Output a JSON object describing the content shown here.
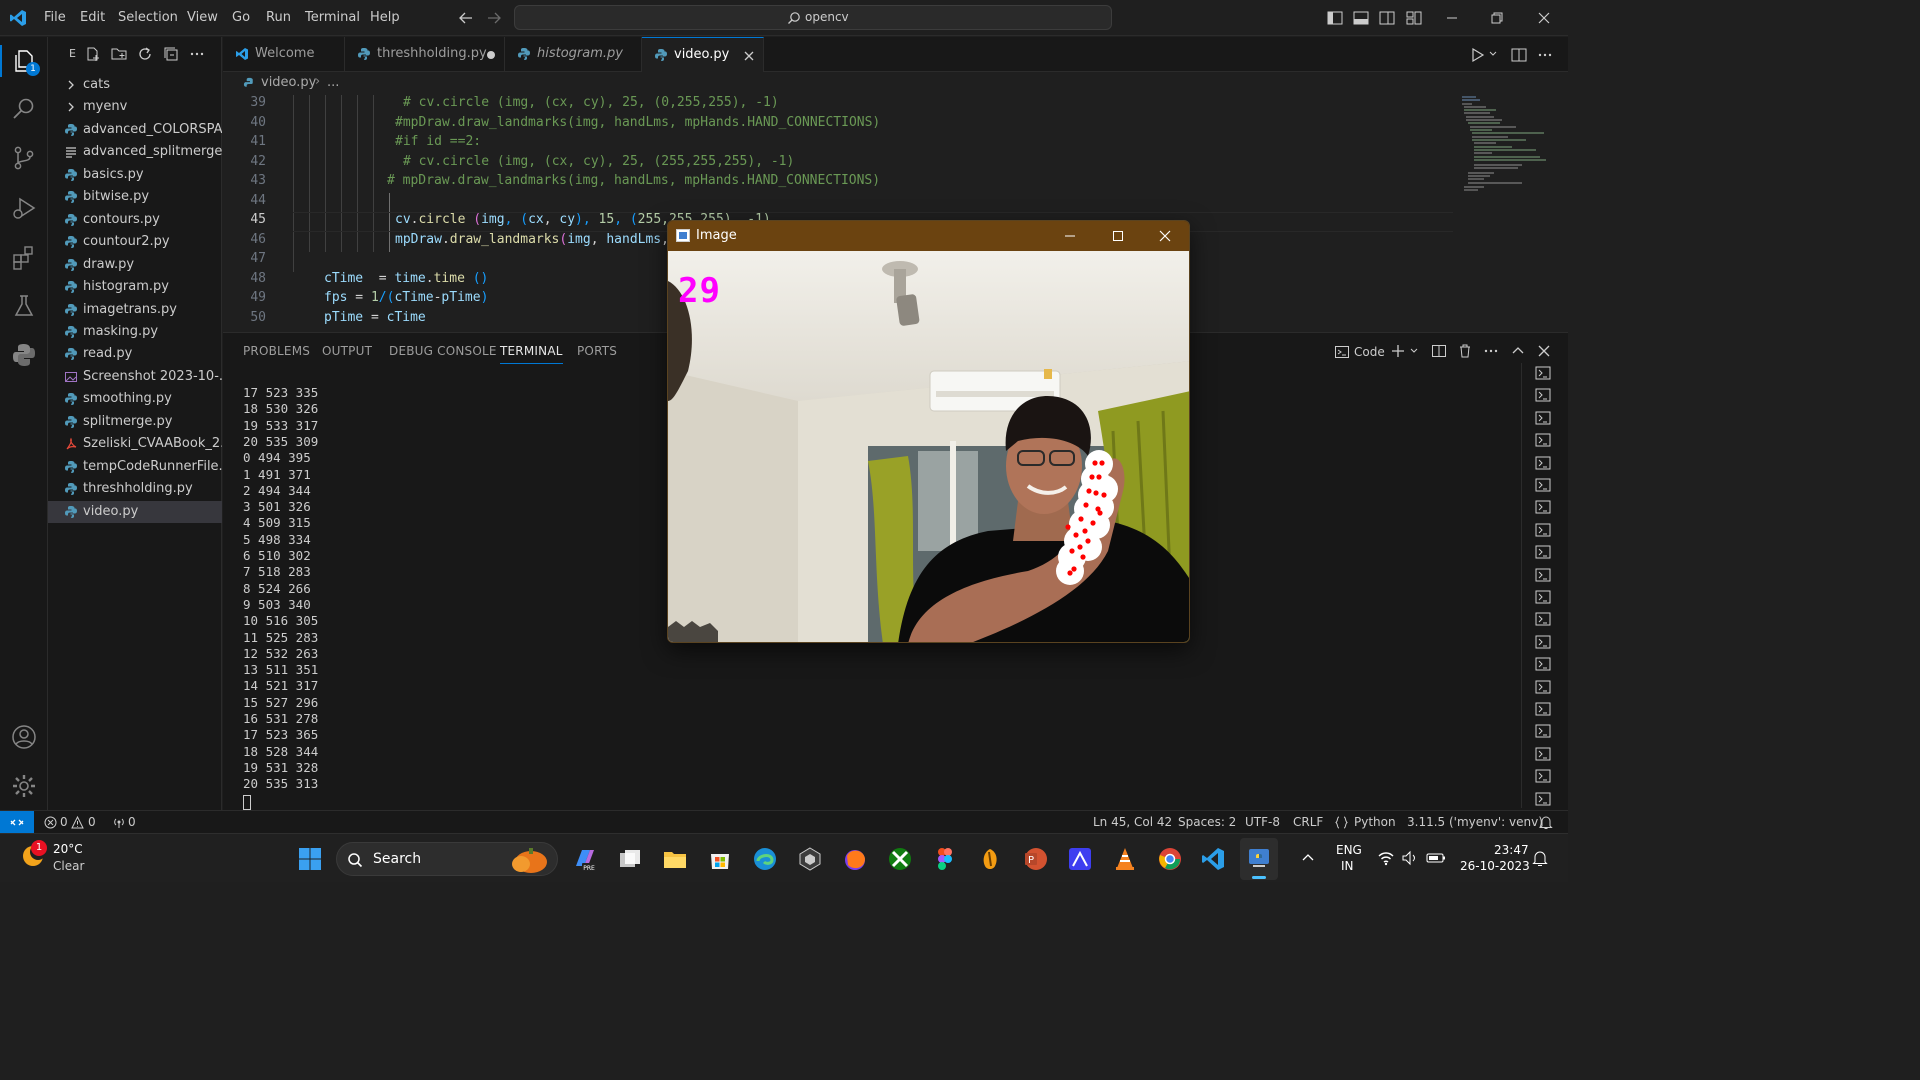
{
  "titlebar": {
    "menu": [
      "File",
      "Edit",
      "Selection",
      "View",
      "Go",
      "Run",
      "Terminal",
      "Help"
    ],
    "command_center": "opencv"
  },
  "activity": {
    "explorer_badge": "1"
  },
  "sidebar": {
    "header_letter": "E",
    "items": [
      {
        "label": "cats",
        "type": "folder"
      },
      {
        "label": "myenv",
        "type": "folder"
      },
      {
        "label": "advanced_COLORSPA...",
        "type": "py"
      },
      {
        "label": "advanced_splitmerge",
        "type": "txt"
      },
      {
        "label": "basics.py",
        "type": "py"
      },
      {
        "label": "bitwise.py",
        "type": "py"
      },
      {
        "label": "contours.py",
        "type": "py"
      },
      {
        "label": "countour2.py",
        "type": "py"
      },
      {
        "label": "draw.py",
        "type": "py"
      },
      {
        "label": "histogram.py",
        "type": "py"
      },
      {
        "label": "imagetrans.py",
        "type": "py"
      },
      {
        "label": "masking.py",
        "type": "py"
      },
      {
        "label": "read.py",
        "type": "py"
      },
      {
        "label": "Screenshot 2023-10-...",
        "type": "img"
      },
      {
        "label": "smoothing.py",
        "type": "py"
      },
      {
        "label": "splitmerge.py",
        "type": "py"
      },
      {
        "label": "Szeliski_CVAABook_2...",
        "type": "pdf"
      },
      {
        "label": "tempCodeRunnerFile....",
        "type": "py"
      },
      {
        "label": "threshholding.py",
        "type": "py"
      },
      {
        "label": "video.py",
        "type": "py",
        "selected": true
      }
    ]
  },
  "tabs": [
    {
      "label": "Welcome",
      "italic": false
    },
    {
      "label": "threshholding.py",
      "italic": false,
      "modified": true
    },
    {
      "label": "histogram.py",
      "italic": true
    },
    {
      "label": "video.py",
      "italic": false,
      "active": true
    }
  ],
  "breadcrumb": {
    "file": "video.py",
    "rest": "..."
  },
  "code": {
    "line_numbers": [
      "39",
      "40",
      "41",
      "42",
      "43",
      "44",
      "45",
      "46",
      "47",
      "48",
      "49",
      "50"
    ],
    "current_line": "45",
    "l39": "# cv.circle (img, (cx, cy), 25, (0,255,255), -1)",
    "l40": "#mpDraw.draw_landmarks(img, handLms, mpHands.HAND_CONNECTIONS)",
    "l41": "#if id ==2:",
    "l42": "# cv.circle (img, (cx, cy), 25, (255,255,255), -1)",
    "l43": "# mpDraw.draw_landmarks(img, handLms, mpHands.HAND_CONNECTIONS)",
    "l45_a": "cv",
    "l45_b": ".",
    "l45_c": "circle",
    "l45_d": " (",
    "l45_e": "img",
    "l45_f": ", (",
    "l45_g": "cx",
    "l45_h": ", ",
    "l45_i": "cy",
    "l45_j": "), ",
    "l45_k": "15",
    "l45_l": ", (",
    "l45_m": "255",
    "l45_n": ",255,255), -1)",
    "l46_a": "mpDraw",
    "l46_b": ".",
    "l46_c": "draw_landmarks",
    "l46_d": "(",
    "l46_e": "img",
    "l46_f": ", ",
    "l46_g": "handLms",
    "l46_h": ",",
    "l48_a": "cTime",
    "l48_b": "  = ",
    "l48_c": "time",
    "l48_d": ".",
    "l48_e": "time",
    "l48_f": " ()",
    "l49_a": "fps",
    "l49_b": " = ",
    "l49_c": "1",
    "l49_d": "/(",
    "l49_e": "cTime",
    "l49_f": "-",
    "l49_g": "pTime",
    "l49_h": ")",
    "l50_a": "pTime",
    "l50_b": " = ",
    "l50_c": "cTime"
  },
  "panel": {
    "tabs": [
      "PROBLEMS",
      "OUTPUT",
      "DEBUG CONSOLE",
      "TERMINAL",
      "PORTS"
    ],
    "active_tab": "TERMINAL",
    "shell_label": "Code",
    "terminal_lines": [
      "17 523 335",
      "18 530 326",
      "19 533 317",
      "20 535 309",
      "0 494 395",
      "1 491 371",
      "2 494 344",
      "3 501 326",
      "4 509 315",
      "5 498 334",
      "6 510 302",
      "7 518 283",
      "8 524 266",
      "9 503 340",
      "10 516 305",
      "11 525 283",
      "12 532 263",
      "13 511 351",
      "14 521 317",
      "15 527 296",
      "16 531 278",
      "17 523 365",
      "18 528 344",
      "19 531 328",
      "20 535 313"
    ]
  },
  "image_window": {
    "title": "Image",
    "fps_overlay": "29"
  },
  "statusbar": {
    "errors": "0",
    "warnings": "0",
    "ports": "0",
    "cursor": "Ln 45, Col 42",
    "spaces": "Spaces: 2",
    "encoding": "UTF-8",
    "eol": "CRLF",
    "language": "Python",
    "interpreter": "3.11.5 ('myenv': venv)"
  },
  "taskbar": {
    "weather_temp": "20°C",
    "weather_desc": "Clear",
    "weather_badge": "1",
    "search": "Search",
    "lang_top": "ENG",
    "lang_bottom": "IN",
    "time": "23:47",
    "date": "26-10-2023"
  },
  "colors": {
    "accent": "#0078d4",
    "python_icon": "#519aba",
    "fps_magenta": "#ff00ff",
    "landmark_red": "#ff0000"
  }
}
